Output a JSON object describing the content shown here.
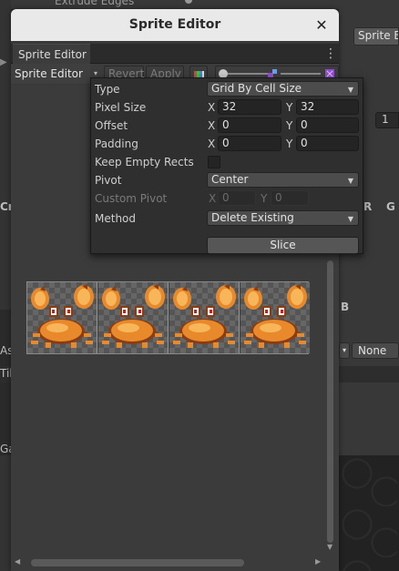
{
  "window": {
    "title": "Sprite Editor",
    "tab_label": "Sprite Editor",
    "toolbar": {
      "mode_dropdown": "Sprite Editor",
      "revert_label": "Revert",
      "apply_label": "Apply"
    }
  },
  "background": {
    "extrude_label": "Extrude Edges",
    "right_button": "Sprite Ed",
    "field_value": "1",
    "r_label": "R",
    "g_label": "G",
    "b_label": "B",
    "none_dropdown": "None",
    "left_labels": [
      "Cr",
      "As",
      "Til",
      "Ga"
    ]
  },
  "slice_popup": {
    "type_label": "Type",
    "type_value": "Grid By Cell Size",
    "pixel_size_label": "Pixel Size",
    "pixel_size_x": "32",
    "pixel_size_y": "32",
    "offset_label": "Offset",
    "offset_x": "0",
    "offset_y": "0",
    "padding_label": "Padding",
    "padding_x": "0",
    "padding_y": "0",
    "keep_empty_label": "Keep Empty Rects",
    "keep_empty_checked": false,
    "pivot_label": "Pivot",
    "pivot_value": "Center",
    "custom_pivot_label": "Custom Pivot",
    "custom_pivot_x": "0",
    "custom_pivot_y": "0",
    "method_label": "Method",
    "method_value": "Delete Existing",
    "slice_label": "Slice",
    "x_axis": "X",
    "y_axis": "Y"
  },
  "colors": {
    "crab_body": "#e88a2c",
    "crab_dark": "#8a3c12",
    "crab_light": "#f8b65a"
  }
}
